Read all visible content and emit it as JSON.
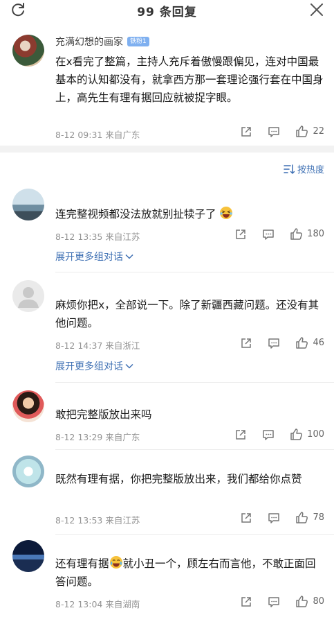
{
  "header": {
    "title": "99 条回复"
  },
  "pinned": {
    "user": "充满幻想的画家",
    "badge": "铁粉1",
    "text": "在x看完了整篇，主持人充斥着傲慢跟偏见，连对中国最基本的认知都没有，就拿西方那一套理论强行套在中国身上，高先生有理有据回应就被捉字眼。",
    "meta": "8-12 09:31  来自广东",
    "likes": "22"
  },
  "sort": {
    "label": "按热度"
  },
  "comments": [
    {
      "text": "连完整视频都没法放就别扯犊子了",
      "meta": "8-12 13:35  来自江苏",
      "likes": "180",
      "expand": "展开更多组对话"
    },
    {
      "text": "麻烦你把x，全部说一下。除了新疆西藏问题。还没有其他问题。",
      "meta": "8-12 14:37  来自浙江",
      "likes": "46",
      "expand": "展开更多组对话"
    },
    {
      "text": "敢把完整版放出来吗",
      "meta": "8-12 13:29  来自广东",
      "likes": "100"
    },
    {
      "text": "既然有理有据，你把完整版放出来，我们都给你点赞",
      "meta": "8-12 13:53  来自江苏",
      "likes": "78"
    },
    {
      "text_a": "还有理有据",
      "text_b": "就小丑一个，顾左右而言他，不敢正面回答问题。",
      "meta": "8-12 13:04  来自湖南",
      "likes": "80"
    }
  ],
  "icons": {
    "refresh": "refresh-icon",
    "close": "close-icon",
    "share": "share-icon",
    "comment": "comment-icon",
    "like": "thumbs-up-icon",
    "sort": "sort-icon",
    "chevron": "chevron-down-icon",
    "emoji_laugh": "laughing-emoji-icon",
    "emoji_cry": "crying-laughing-emoji-icon"
  }
}
